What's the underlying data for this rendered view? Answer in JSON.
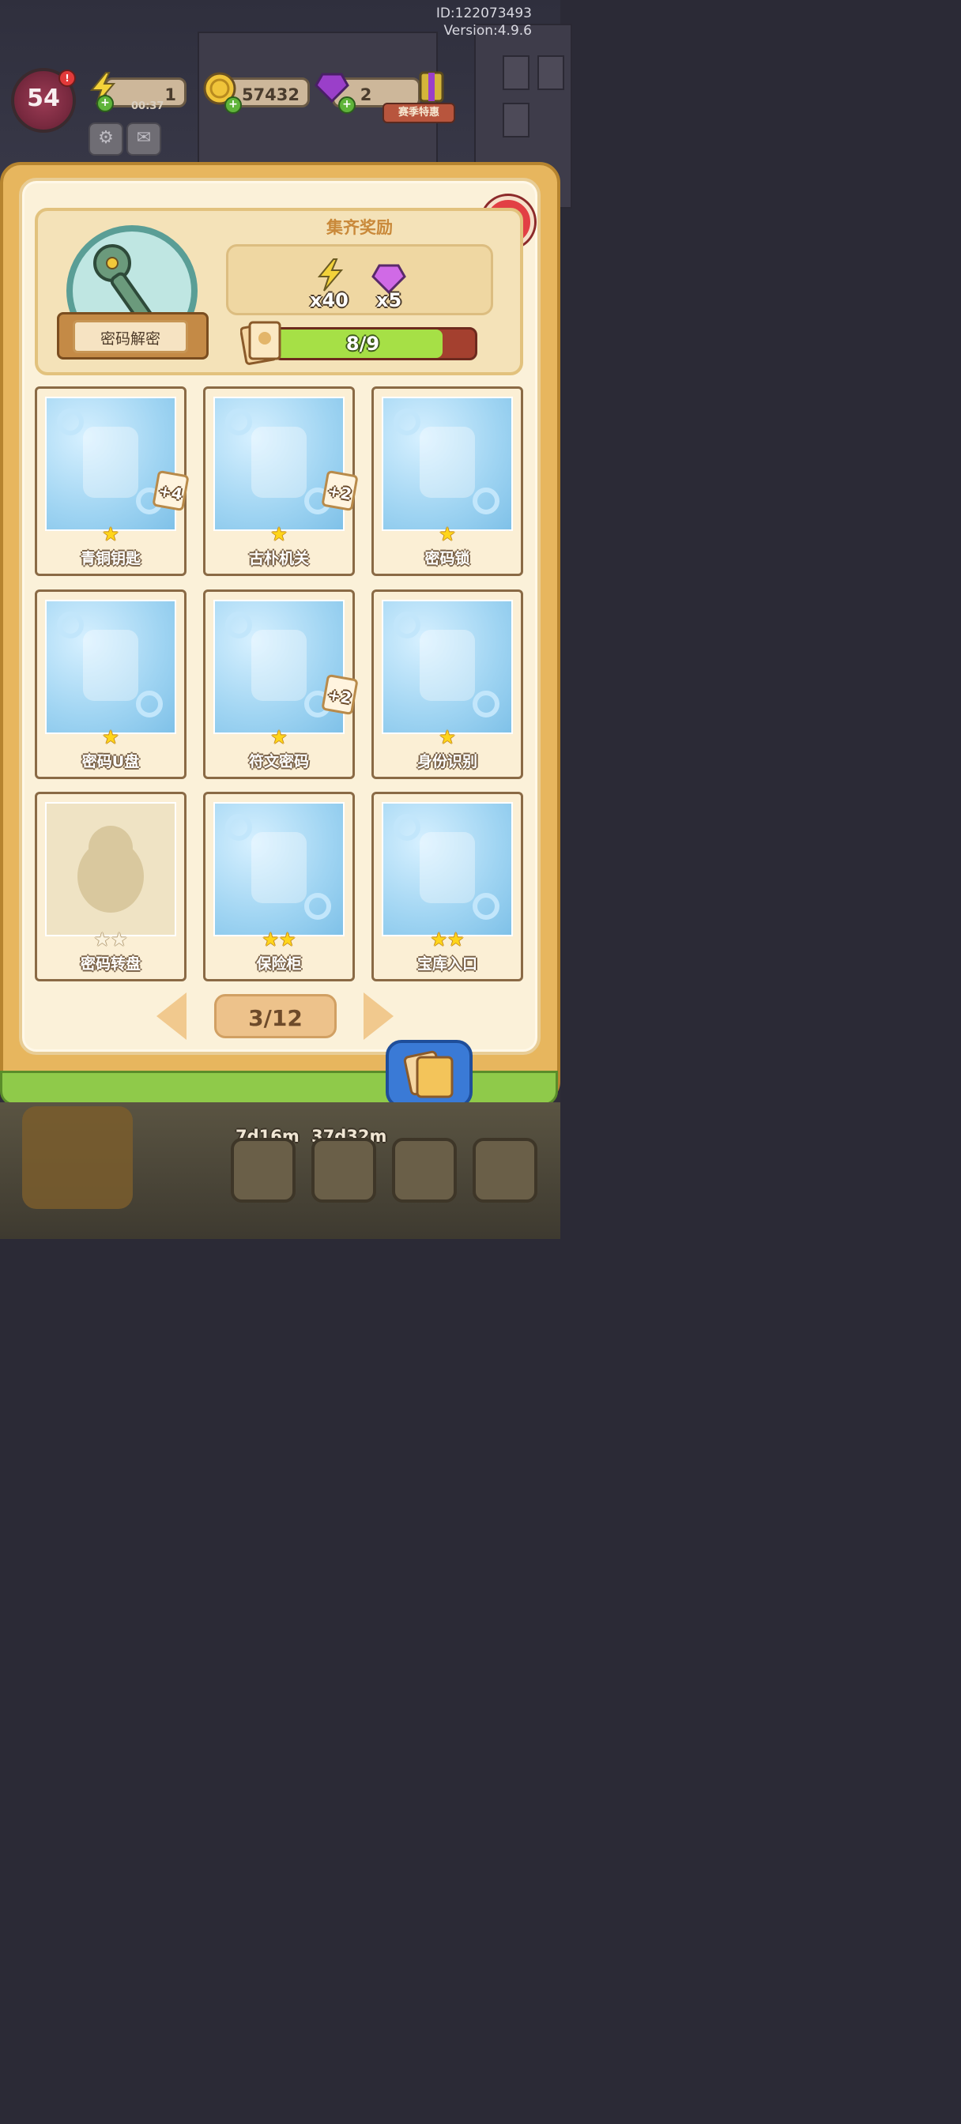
{
  "meta": {
    "id_text": "ID:122073493",
    "version_text": "Version:4.9.6"
  },
  "hud": {
    "level": "54",
    "energy": "1",
    "energy_timer": "00:37",
    "coins": "57432",
    "gems": "2",
    "event_label": "赛季特惠"
  },
  "collection": {
    "set_name": "密码解密",
    "reward_title": "集齐奖励",
    "rewards": [
      {
        "icon": "energy-bolt-icon",
        "amount": "x40"
      },
      {
        "icon": "gem-icon",
        "amount": "x5"
      }
    ],
    "progress_text": "8/9",
    "progress_fraction": 0.889
  },
  "cards": [
    {
      "name": "青铜钥匙",
      "stars": 1,
      "badge": "+4",
      "collected": true
    },
    {
      "name": "古朴机关",
      "stars": 1,
      "badge": "+2",
      "collected": true
    },
    {
      "name": "密码锁",
      "stars": 1,
      "badge": "",
      "collected": true
    },
    {
      "name": "密码U盘",
      "stars": 1,
      "badge": "",
      "collected": true
    },
    {
      "name": "符文密码",
      "stars": 1,
      "badge": "+2",
      "collected": true
    },
    {
      "name": "身份识别",
      "stars": 1,
      "badge": "",
      "collected": true
    },
    {
      "name": "密码转盘",
      "stars": 2,
      "badge": "",
      "collected": false
    },
    {
      "name": "保险柜",
      "stars": 2,
      "badge": "",
      "collected": true
    },
    {
      "name": "宝库入口",
      "stars": 2,
      "badge": "",
      "collected": true
    }
  ],
  "pager": {
    "text": "3/12"
  },
  "bottom": {
    "timer1": "7d16m",
    "timer2": "37d32m"
  }
}
